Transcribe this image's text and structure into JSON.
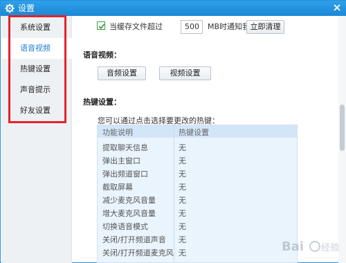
{
  "window": {
    "title": "设置"
  },
  "sidebar": {
    "items": [
      {
        "label": "系统设置"
      },
      {
        "label": "语音视频"
      },
      {
        "label": "热键设置"
      },
      {
        "label": "声音提示"
      },
      {
        "label": "好友设置"
      }
    ],
    "active_index": 1
  },
  "cache": {
    "checkbox_label": "当缓存文件超过",
    "checked": true,
    "size_value": "500",
    "unit_label": "MB时通知我",
    "clear_button": "立即清理"
  },
  "voice_video": {
    "title": "语音视频：",
    "audio_button": "音频设置",
    "video_button": "视频设置"
  },
  "hotkeys": {
    "title": "热键设置：",
    "hint": "您可以通过点击选择要更改的热键：",
    "columns": [
      "功能说明",
      "热键设置"
    ],
    "rows": [
      {
        "func": "提取聊天信息",
        "key": "无"
      },
      {
        "func": "弹出主窗口",
        "key": "无"
      },
      {
        "func": "弹出频道窗口",
        "key": "无"
      },
      {
        "func": "截取屏幕",
        "key": "无"
      },
      {
        "func": "减少麦克风音量",
        "key": "无"
      },
      {
        "func": "增大麦克风音量",
        "key": "无"
      },
      {
        "func": "切换语音模式",
        "key": "无"
      },
      {
        "func": "关闭/打开频道声音",
        "key": "无"
      },
      {
        "func": "关闭/打开频道麦克风",
        "key": "无"
      }
    ]
  },
  "colors": {
    "titlebar": "#1c88d5",
    "highlight_border": "#e8202a",
    "active_text": "#1c7fd3",
    "checkbox_green": "#37a043"
  },
  "icons": {
    "title_icon": "gear-icon",
    "close_icon": "close-icon",
    "checkbox_icon": "checkmark-icon"
  }
}
